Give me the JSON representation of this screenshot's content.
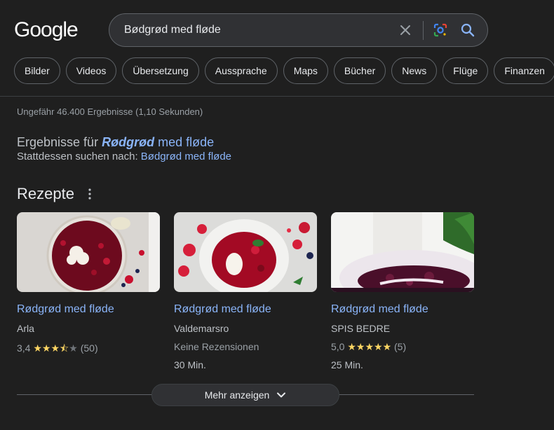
{
  "logo": "Google",
  "search": {
    "query": "Bødgrød med fløde"
  },
  "chips": [
    "Bilder",
    "Videos",
    "Übersetzung",
    "Aussprache",
    "Maps",
    "Bücher",
    "News",
    "Flüge",
    "Finanzen"
  ],
  "stats": "Ungefähr 46.400 Ergebnisse (1,10 Sekunden)",
  "spelling": {
    "prefix": "Ergebnisse für",
    "corrected_bold": "Rødgrød",
    "corrected_rest": "med fløde",
    "instead_prefix": "Stattdessen suchen nach:",
    "instead_query": "Bødgrød med fløde"
  },
  "recipes": {
    "title": "Rezepte",
    "cards": [
      {
        "title": "Rødgrød med fløde",
        "source": "Arla",
        "rating_value": "3,4",
        "stars": "★★★",
        "star_half": "⯪",
        "star_empty": "★",
        "reviews": "(50)",
        "time": ""
      },
      {
        "title": "Rødgrød med fløde",
        "source": "Valdemarsro",
        "no_reviews": "Keine Rezensionen",
        "time": "30 Min."
      },
      {
        "title": "Rødgrød med fløde",
        "source": "SPIS BEDRE",
        "rating_value": "5,0",
        "stars": "★★★★★",
        "reviews": "(5)",
        "time": "25 Min."
      }
    ],
    "more_label": "Mehr anzeigen"
  },
  "colors": {
    "link": "#8ab4f8",
    "star": "#fdd663",
    "background": "#1f1f1f"
  }
}
